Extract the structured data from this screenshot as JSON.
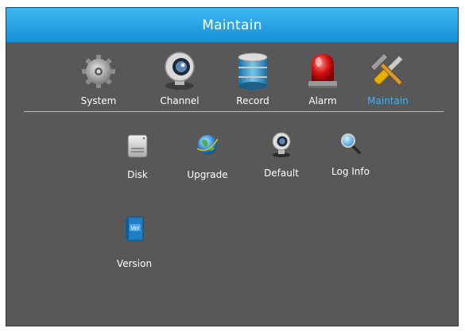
{
  "window": {
    "title": "Maintain"
  },
  "nav": {
    "items": [
      {
        "label": "System",
        "icon": "gear-icon"
      },
      {
        "label": "Channel",
        "icon": "camera-icon"
      },
      {
        "label": "Record",
        "icon": "database-icon"
      },
      {
        "label": "Alarm",
        "icon": "siren-icon"
      },
      {
        "label": "Maintain",
        "icon": "tools-icon",
        "active": true
      }
    ]
  },
  "maintain": {
    "items": [
      {
        "label": "Disk",
        "icon": "hard-disk-icon"
      },
      {
        "label": "Upgrade",
        "icon": "globe-icon"
      },
      {
        "label": "Default",
        "icon": "webcam-icon"
      },
      {
        "label": "Log Info",
        "icon": "magnifier-icon"
      },
      {
        "label": "Version",
        "icon": "book-icon"
      }
    ]
  },
  "colors": {
    "titlebar": "#1f9be0",
    "background": "#585858",
    "active_label": "#3fb0ff"
  }
}
